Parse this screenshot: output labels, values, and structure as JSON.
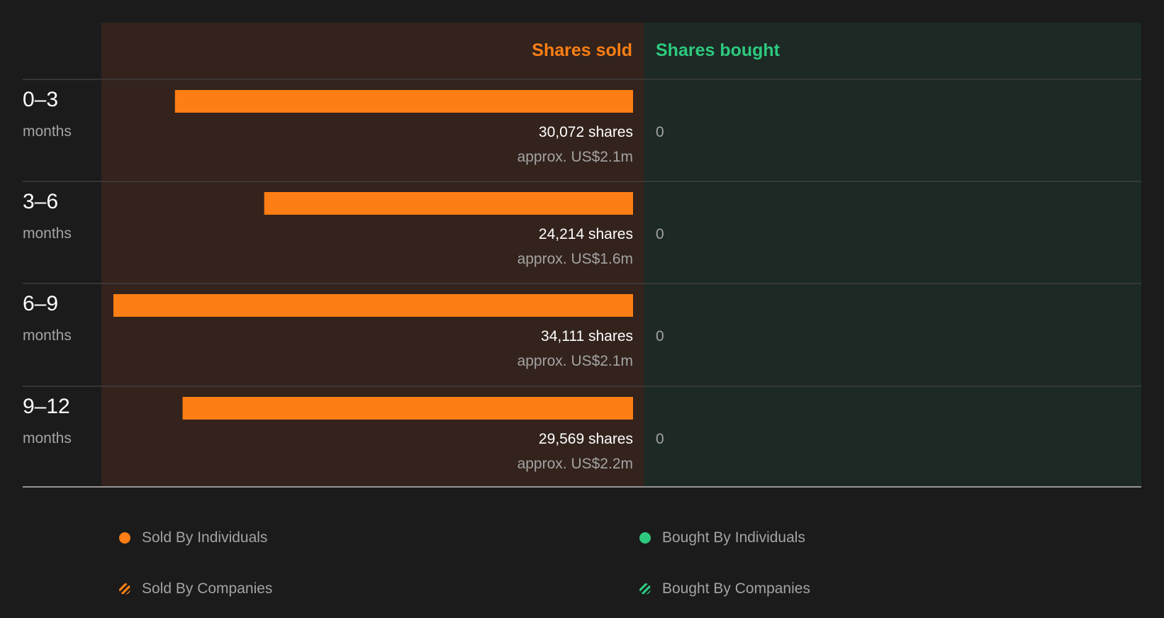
{
  "chart_data": {
    "type": "bar",
    "orientation": "horizontal",
    "headers": {
      "sold": "Shares sold",
      "bought": "Shares bought"
    },
    "categories": [
      {
        "period": "0-3",
        "unit": "months"
      },
      {
        "period": "3-6",
        "unit": "months"
      },
      {
        "period": "6-9",
        "unit": "months"
      },
      {
        "period": "9-12",
        "unit": "months"
      }
    ],
    "series": [
      {
        "name": "Sold By Individuals",
        "side": "sold",
        "values": [
          30072,
          24214,
          34111,
          29569
        ],
        "labels": [
          "30,072 shares",
          "24,214 shares",
          "34,111 shares",
          "29,569 shares"
        ],
        "approx": [
          "approx. US$2.1m",
          "approx. US$1.6m",
          "approx. US$2.1m",
          "approx. US$2.2m"
        ]
      },
      {
        "name": "Bought By Individuals",
        "side": "bought",
        "values": [
          0,
          0,
          0,
          0
        ],
        "labels": [
          "0",
          "0",
          "0",
          "0"
        ]
      }
    ],
    "legend": [
      {
        "label": "Sold By Individuals",
        "style": "solid-orange"
      },
      {
        "label": "Bought By Individuals",
        "style": "solid-green"
      },
      {
        "label": "Sold By Companies",
        "style": "hatched-orange"
      },
      {
        "label": "Bought By Companies",
        "style": "hatched-green"
      }
    ],
    "legend_position": "bottom",
    "colors": {
      "sold": "#fd7e14",
      "bought": "#2dc97e",
      "sold_panel": "#33231c",
      "bought_panel": "#1c2924",
      "background": "#1b1b1b"
    }
  }
}
